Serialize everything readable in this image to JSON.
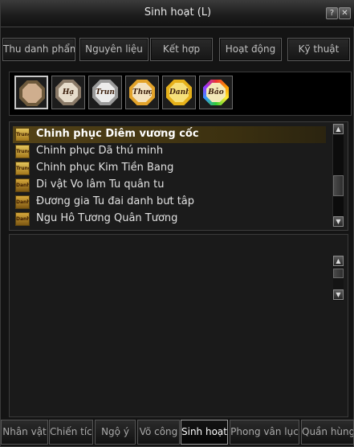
{
  "window": {
    "title": "Sinh hoạt (L)",
    "help_label": "?",
    "close_label": "✕"
  },
  "top_tabs": [
    {
      "label": "Thu danh phẩm",
      "active": true
    },
    {
      "label": "Nguyên liệu",
      "active": false
    },
    {
      "label": "Kết hợp",
      "active": false
    },
    {
      "label": "Hoạt động",
      "active": false
    },
    {
      "label": "Kỹ thuật",
      "active": false
    }
  ],
  "medals": [
    {
      "text": "",
      "ring": "#6e5a3c",
      "core": "#cfae8e",
      "selected": true
    },
    {
      "text": "Hạ",
      "ring": "#8a7a68",
      "core": "#e6dccb",
      "selected": false
    },
    {
      "text": "Trung",
      "ring": "#9a9a9a",
      "core": "#ececec",
      "selected": false
    },
    {
      "text": "Thượng",
      "ring": "#e3a32a",
      "core": "#f3e2c0",
      "selected": false
    },
    {
      "text": "Danh",
      "ring": "#e6b11a",
      "core": "#f6e07a",
      "selected": false
    },
    {
      "text": "Bảo",
      "ring": "#d83c8c",
      "core": "#f3e9b8",
      "selected": false
    }
  ],
  "list_items": [
    {
      "label": "Chinh phục Diêm vương cốc",
      "selected": true,
      "icon_text": "Trung"
    },
    {
      "label": "Chinh phục Dã thú minh",
      "selected": false,
      "icon_text": "Trung"
    },
    {
      "label": "Chinh phục Kim Tiền Bang",
      "selected": false,
      "icon_text": "Trung"
    },
    {
      "label": "Di vật Vo lâm Tu quân tu",
      "selected": false,
      "icon_text": "Danh"
    },
    {
      "label": "Đương gia Tu đai danh bưt tâp",
      "selected": false,
      "icon_text": "Danh"
    },
    {
      "label": "Ngu Hô Tương Quân Tương",
      "selected": false,
      "icon_text": "Danh"
    }
  ],
  "bottom_tabs": [
    {
      "label": "Nhân vật",
      "active": false
    },
    {
      "label": "Chiến tích",
      "active": false
    },
    {
      "label": "Ngộ ý",
      "active": false
    },
    {
      "label": "Võ công",
      "active": false
    },
    {
      "label": "Sinh hoạt",
      "active": true
    },
    {
      "label": "Phong vân lục",
      "active": false
    },
    {
      "label": "Quần hùng",
      "active": false
    }
  ],
  "scroll": {
    "up_label": "▲",
    "down_label": "▼"
  }
}
